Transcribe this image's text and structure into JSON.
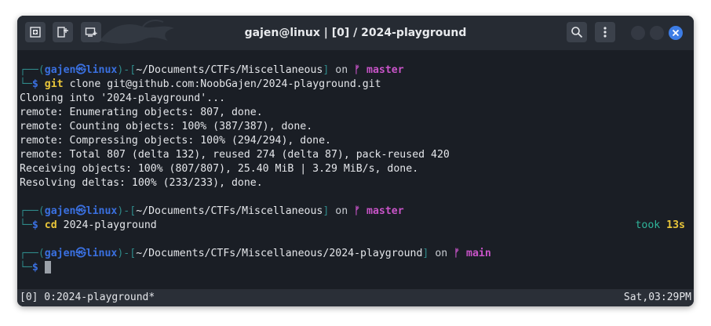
{
  "window": {
    "title": "gajen@linux | [0] / 2024-playground"
  },
  "titlebar_buttons": [
    {
      "icon": "new-tab-icon"
    },
    {
      "icon": "split-view-icon"
    },
    {
      "icon": "new-window-icon"
    }
  ],
  "prompts": [
    {
      "open": "┌──(",
      "user": "gajen㉿linux",
      "mid": ")-[",
      "path": "~/Documents/CTFs/Miscellaneous",
      "close": "]",
      "on": "on",
      "branch_icon": "ᚠ",
      "branch": "master",
      "dollar_prefix": "└─",
      "dollar": "$",
      "cmd": "git",
      "args": "clone git@github.com:NoobGajen/2024-playground.git"
    },
    {
      "open": "┌──(",
      "user": "gajen㉿linux",
      "mid": ")-[",
      "path": "~/Documents/CTFs/Miscellaneous",
      "close": "]",
      "on": "on",
      "branch_icon": "ᚠ",
      "branch": "master",
      "dollar_prefix": "└─",
      "dollar": "$",
      "cmd": "cd",
      "args": "2024-playground",
      "took_label": "took",
      "took_value": "13s"
    },
    {
      "open": "┌──(",
      "user": "gajen㉿linux",
      "mid": ")-[",
      "path": "~/Documents/CTFs/Miscellaneous/2024-playground",
      "close": "]",
      "on": "on",
      "branch_icon": "ᚠ",
      "branch": "main",
      "dollar_prefix": "└─",
      "dollar": "$"
    }
  ],
  "output": [
    "Cloning into '2024-playground'...",
    "remote: Enumerating objects: 807, done.",
    "remote: Counting objects: 100% (387/387), done.",
    "remote: Compressing objects: 100% (294/294), done.",
    "remote: Total 807 (delta 132), reused 274 (delta 87), pack-reused 420",
    "Receiving objects: 100% (807/807), 25.40 MiB | 3.29 MiB/s, done.",
    "Resolving deltas: 100% (233/233), done."
  ],
  "statusbar": {
    "left": "[0] 0:2024-playground*",
    "right": "Sat,03:29PM"
  },
  "colors": {
    "user": "#3a70e0",
    "branch": "#c854c8",
    "command": "#e9c63a",
    "took": "#2fb59b",
    "accent_close": "#3d7de6"
  }
}
